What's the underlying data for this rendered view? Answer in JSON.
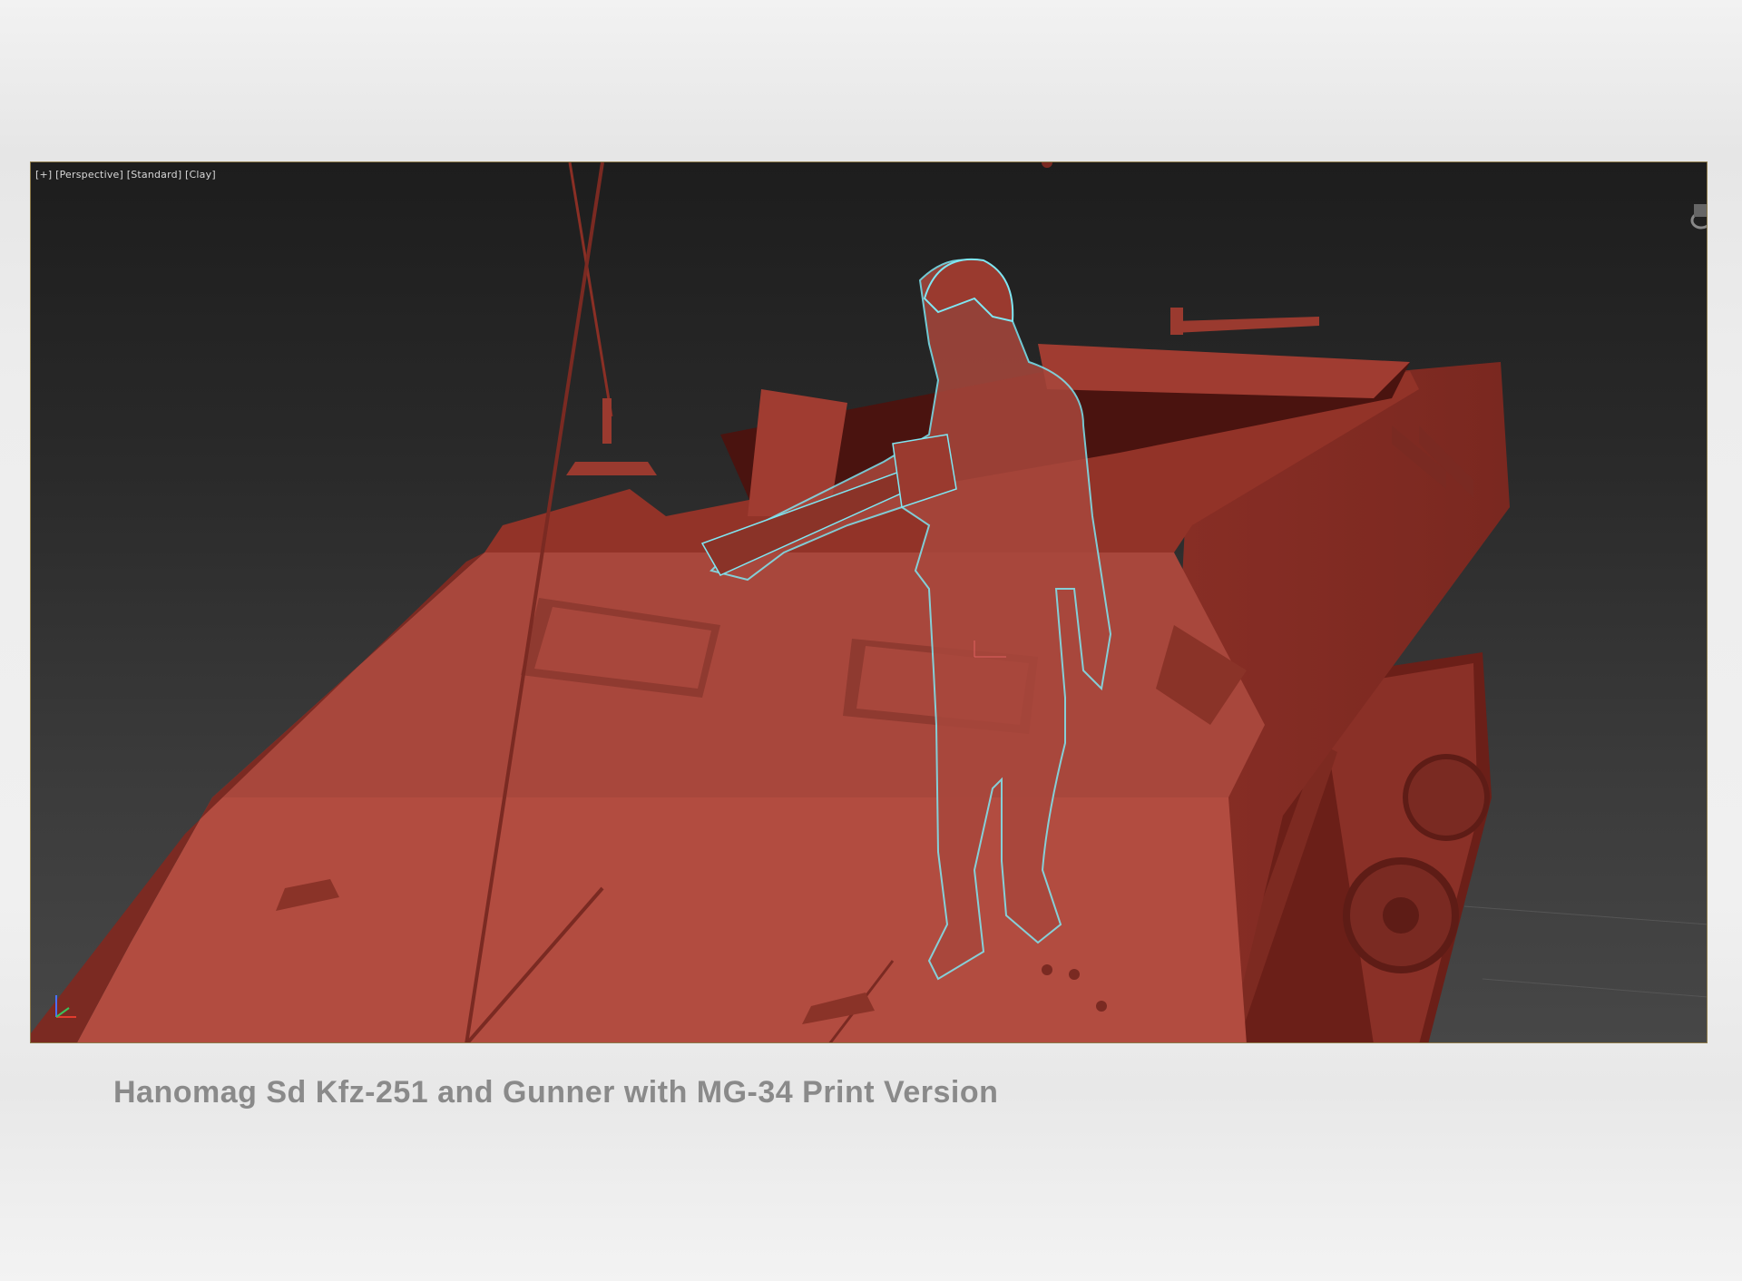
{
  "viewport": {
    "label_plus": "[+]",
    "label_view": "[Perspective]",
    "label_shading": "[Standard]",
    "label_style": "[Clay]",
    "model_color": "#b24c40",
    "selection_outline_color": "#7fe6f2",
    "background_top": "#1d1d1d",
    "background_bottom": "#474747"
  },
  "icons": {
    "axis_gizmo": "xyz-axis-gizmo-icon",
    "viewcube": "viewcube-icon"
  },
  "caption": {
    "text": "Hanomag Sd Kfz-251 and Gunner with MG-34 Print Version"
  }
}
